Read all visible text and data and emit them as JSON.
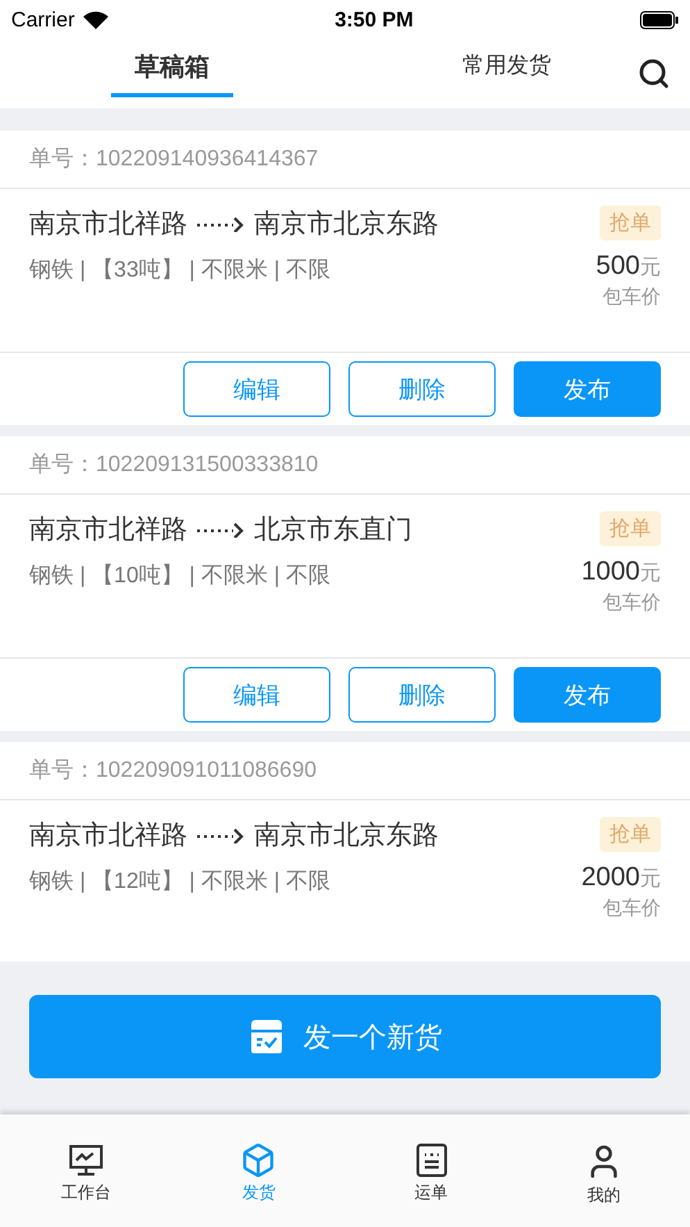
{
  "status_bar": {
    "carrier": "Carrier",
    "time": "3:50 PM"
  },
  "tabs": [
    {
      "label": "草稿箱",
      "selected": true
    },
    {
      "label": "常用发货",
      "selected": false
    }
  ],
  "cards": [
    {
      "order_label": "单号：",
      "order_no": "102209140936414367",
      "from": "南京市北祥路",
      "to": "南京市北京东路",
      "tag": "抢单",
      "details": "钢铁 | 【33吨】 | 不限米 | 不限",
      "price": "500",
      "unit": "元",
      "price_note": "包车价",
      "actions": [
        {
          "label": "编辑",
          "kind": "outline"
        },
        {
          "label": "删除",
          "kind": "outline"
        },
        {
          "label": "发布",
          "kind": "primary"
        }
      ]
    },
    {
      "order_label": "单号：",
      "order_no": "102209131500333810",
      "from": "南京市北祥路",
      "to": "北京市东直门",
      "tag": "抢单",
      "details": "钢铁 | 【10吨】 | 不限米 | 不限",
      "price": "1000",
      "unit": "元",
      "price_note": "包车价",
      "actions": [
        {
          "label": "编辑",
          "kind": "outline"
        },
        {
          "label": "删除",
          "kind": "outline"
        },
        {
          "label": "发布",
          "kind": "primary"
        }
      ]
    },
    {
      "order_label": "单号：",
      "order_no": "102209091011086690",
      "from": "南京市北祥路",
      "to": "南京市北京东路",
      "tag": "抢单",
      "details": "钢铁 | 【12吨】 | 不限米 | 不限",
      "price": "2000",
      "unit": "元",
      "price_note": "包车价"
    }
  ],
  "new_button": "发一个新货",
  "tab_bar": [
    {
      "label": "工作台",
      "kind": "monitor",
      "selected": false
    },
    {
      "label": "发货",
      "kind": "box",
      "selected": true
    },
    {
      "label": "运单",
      "kind": "sheet",
      "selected": false
    },
    {
      "label": "我的",
      "kind": "user",
      "selected": false
    }
  ]
}
